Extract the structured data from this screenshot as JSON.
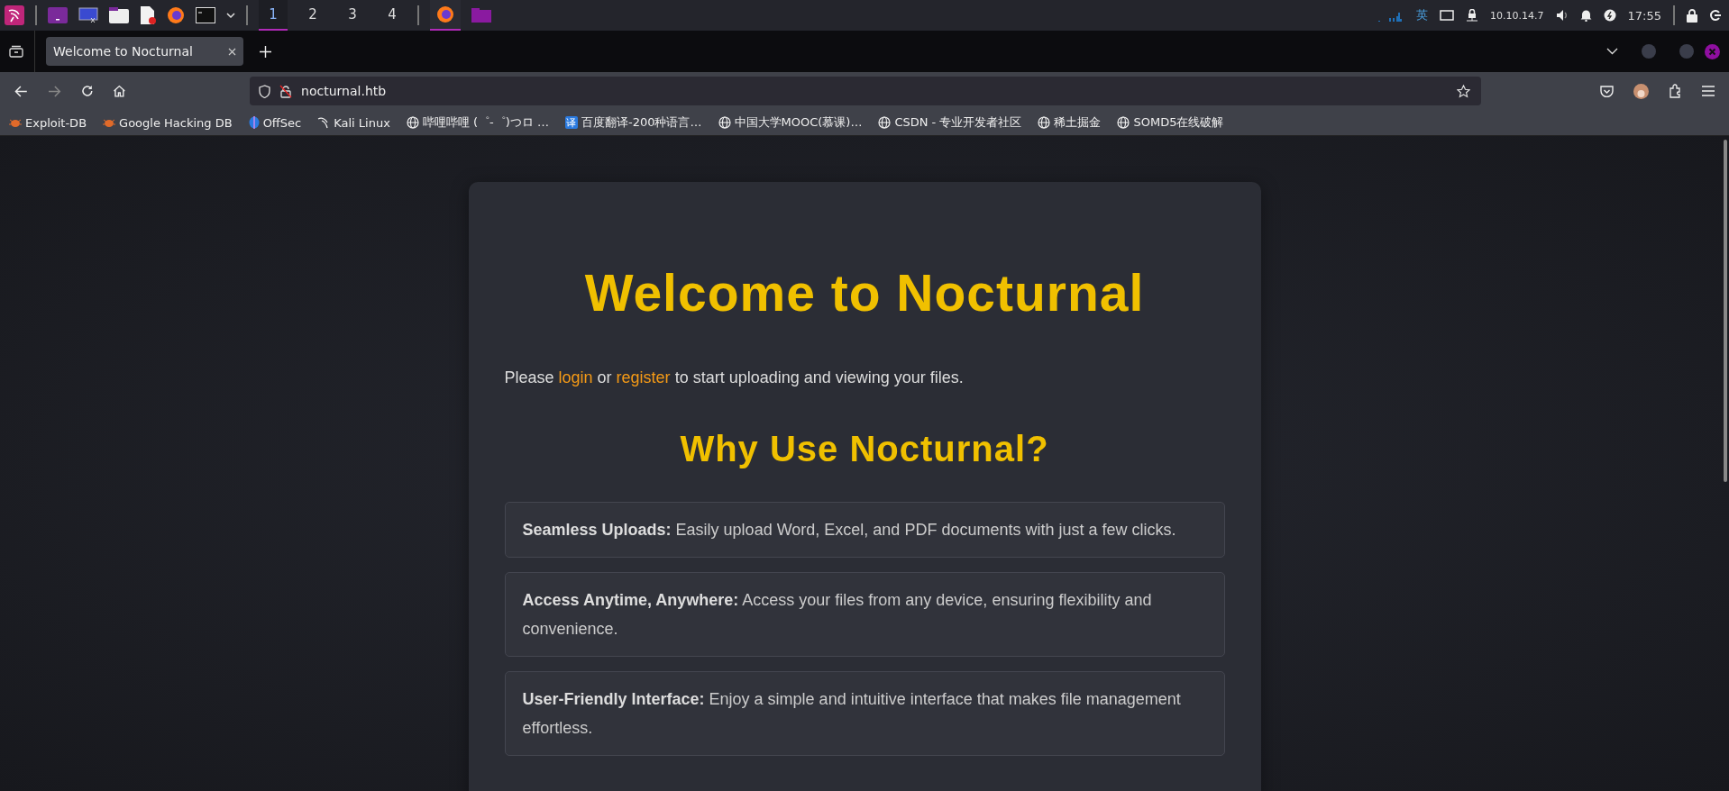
{
  "taskbar": {
    "workspaces": [
      {
        "label": "1",
        "selected": true
      },
      {
        "label": "2",
        "selected": false
      },
      {
        "label": "3",
        "selected": false
      },
      {
        "label": "4",
        "selected": false
      }
    ],
    "tray": {
      "input_method": "英",
      "ip": "10.10.14.7",
      "clock": "17:55"
    }
  },
  "browser": {
    "tabs": [
      {
        "title": "Welcome to Nocturnal",
        "selected": true
      }
    ],
    "url": "nocturnal.htb",
    "bookmarks": [
      {
        "label": "Exploit-DB",
        "kind": "bug"
      },
      {
        "label": "Google Hacking DB",
        "kind": "bug"
      },
      {
        "label": "OffSec",
        "kind": "offsec"
      },
      {
        "label": "Kali Linux",
        "kind": "kali"
      },
      {
        "label": "哔哩哔哩 (゜-゜)つロ …",
        "kind": "globe"
      },
      {
        "label": "百度翻译-200种语言…",
        "kind": "translate",
        "icon_text": "译"
      },
      {
        "label": "中国大学MOOC(慕课)…",
        "kind": "globe"
      },
      {
        "label": "CSDN - 专业开发者社区",
        "kind": "globe"
      },
      {
        "label": "稀土掘金",
        "kind": "globe"
      },
      {
        "label": "SOMD5在线破解",
        "kind": "globe"
      }
    ]
  },
  "page": {
    "title": "Welcome to Nocturnal",
    "intro": [
      {
        "kind": "text",
        "text": "Please "
      },
      {
        "kind": "link",
        "text": "login"
      },
      {
        "kind": "text",
        "text": " or "
      },
      {
        "kind": "link",
        "text": "register"
      },
      {
        "kind": "text",
        "text": " to start uploading and viewing your files."
      }
    ],
    "subtitle": "Why Use Nocturnal?",
    "features": [
      {
        "name": "Seamless Uploads:",
        "text": "Easily upload Word, Excel, and PDF documents with just a few clicks."
      },
      {
        "name": "Access Anytime, Anywhere:",
        "text": "Access your files from any device, ensuring flexibility and convenience."
      },
      {
        "name": "User-Friendly Interface:",
        "text": "Enjoy a simple and intuitive interface that makes file management effortless."
      }
    ]
  }
}
